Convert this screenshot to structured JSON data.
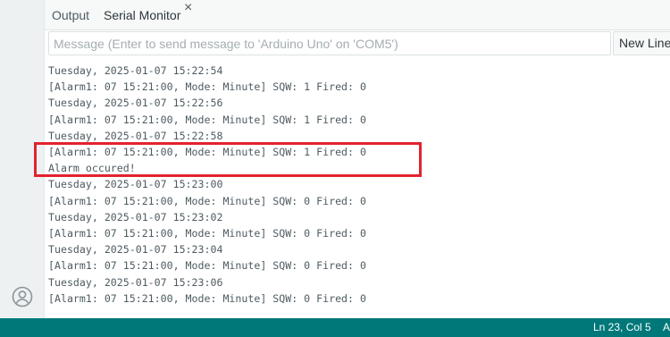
{
  "tabs": {
    "output_label": "Output",
    "serial_label": "Serial Monitor",
    "close_glyph": "×"
  },
  "message_bar": {
    "placeholder": "Message (Enter to send message to 'Arduino Uno' on 'COM5')",
    "value": "",
    "line_ending": "New Line"
  },
  "serial_output": [
    "Tuesday, 2025-01-07 15:22:54",
    "[Alarm1: 07 15:21:00, Mode: Minute] SQW: 1 Fired: 0",
    "Tuesday, 2025-01-07 15:22:56",
    "[Alarm1: 07 15:21:00, Mode: Minute] SQW: 1 Fired: 0",
    "Tuesday, 2025-01-07 15:22:58",
    "[Alarm1: 07 15:21:00, Mode: Minute] SQW: 1 Fired: 0",
    "Alarm occured!",
    "Tuesday, 2025-01-07 15:23:00",
    "[Alarm1: 07 15:21:00, Mode: Minute] SQW: 0 Fired: 0",
    "Tuesday, 2025-01-07 15:23:02",
    "[Alarm1: 07 15:21:00, Mode: Minute] SQW: 0 Fired: 0",
    "Tuesday, 2025-01-07 15:23:04",
    "[Alarm1: 07 15:21:00, Mode: Minute] SQW: 0 Fired: 0",
    "Tuesday, 2025-01-07 15:23:06",
    "[Alarm1: 07 15:21:00, Mode: Minute] SQW: 0 Fired: 0"
  ],
  "status_bar": {
    "cursor_position": "Ln 23, Col 5",
    "board_fragment": "A"
  },
  "colors": {
    "status_bar": "#00787a",
    "highlight": "#e2232e"
  },
  "icons": {
    "account": "account-icon",
    "close": "close-icon"
  }
}
